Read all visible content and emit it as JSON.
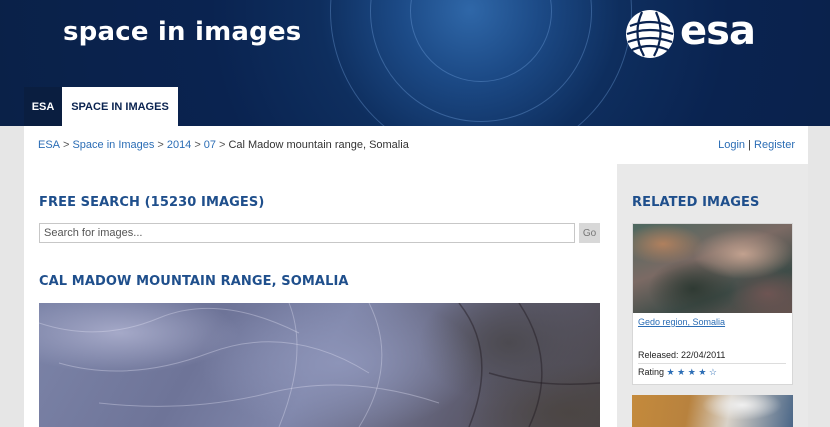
{
  "header": {
    "site_title": "space in images",
    "logo_text": "esa",
    "tabs": [
      {
        "label": "ESA"
      },
      {
        "label": "SPACE IN IMAGES"
      }
    ]
  },
  "breadcrumb": {
    "items": [
      "ESA",
      "Space in Images",
      "2014",
      "07"
    ],
    "current": "Cal Madow mountain range, Somalia",
    "separator": ">"
  },
  "auth": {
    "login": "Login",
    "divider": "|",
    "register": "Register"
  },
  "search": {
    "heading": "FREE SEARCH (15230 IMAGES)",
    "placeholder": "Search for images...",
    "go_label": "Go"
  },
  "main": {
    "title": "CAL MADOW MOUNTAIN RANGE, SOMALIA"
  },
  "sidebar": {
    "heading": "RELATED IMAGES",
    "items": [
      {
        "caption": "Gedo region, Somalia",
        "released_label": "Released:",
        "released_date": "22/04/2011",
        "rating_label": "Rating",
        "rating": 4,
        "rating_max": 5
      }
    ]
  },
  "colors": {
    "accent": "#1f4f8c",
    "link": "#2b6db5",
    "header_bg": "#0a2350"
  }
}
